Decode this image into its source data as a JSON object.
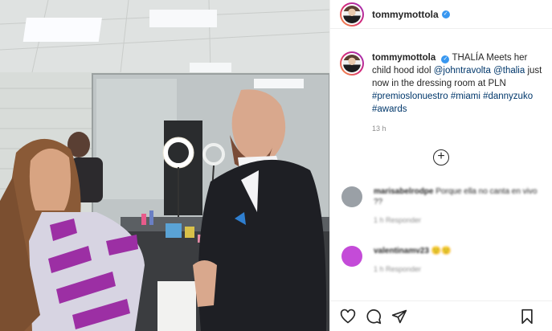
{
  "post": {
    "username": "tommymottola",
    "verified_glyph": "✓",
    "caption": {
      "username": "tommymottola",
      "text_1": "THALÍA Meets her child hood idol ",
      "mention_1": "@johntravolta",
      "text_2": " ",
      "mention_2": "@thalia",
      "text_3": " just now in the dressing room at PLN ",
      "hashtag_1": "#premioslonuestro",
      "text_4": " ",
      "hashtag_2": "#miami",
      "text_5": " ",
      "hashtag_3": "#dannyzuko",
      "text_6": " ",
      "hashtag_4": "#awards"
    },
    "time": "13 h",
    "load_more_glyph": "+"
  },
  "comments": [
    {
      "username": "marisabelrodpe",
      "text": "Porque ella no canta en vivo ??",
      "meta": "1 h  Responder",
      "avatar_color": "#9aa0a6"
    },
    {
      "username": "valentinamv23",
      "text": "🙂🙂",
      "meta": "1 h  Responder",
      "avatar_color": "#c44bd8"
    }
  ],
  "icons": {
    "like": "heart-icon",
    "comment": "comment-icon",
    "share": "share-icon",
    "save": "bookmark-icon"
  },
  "colors": {
    "link": "#00376b",
    "verified": "#3897f0",
    "muted": "#8e8e8e"
  }
}
